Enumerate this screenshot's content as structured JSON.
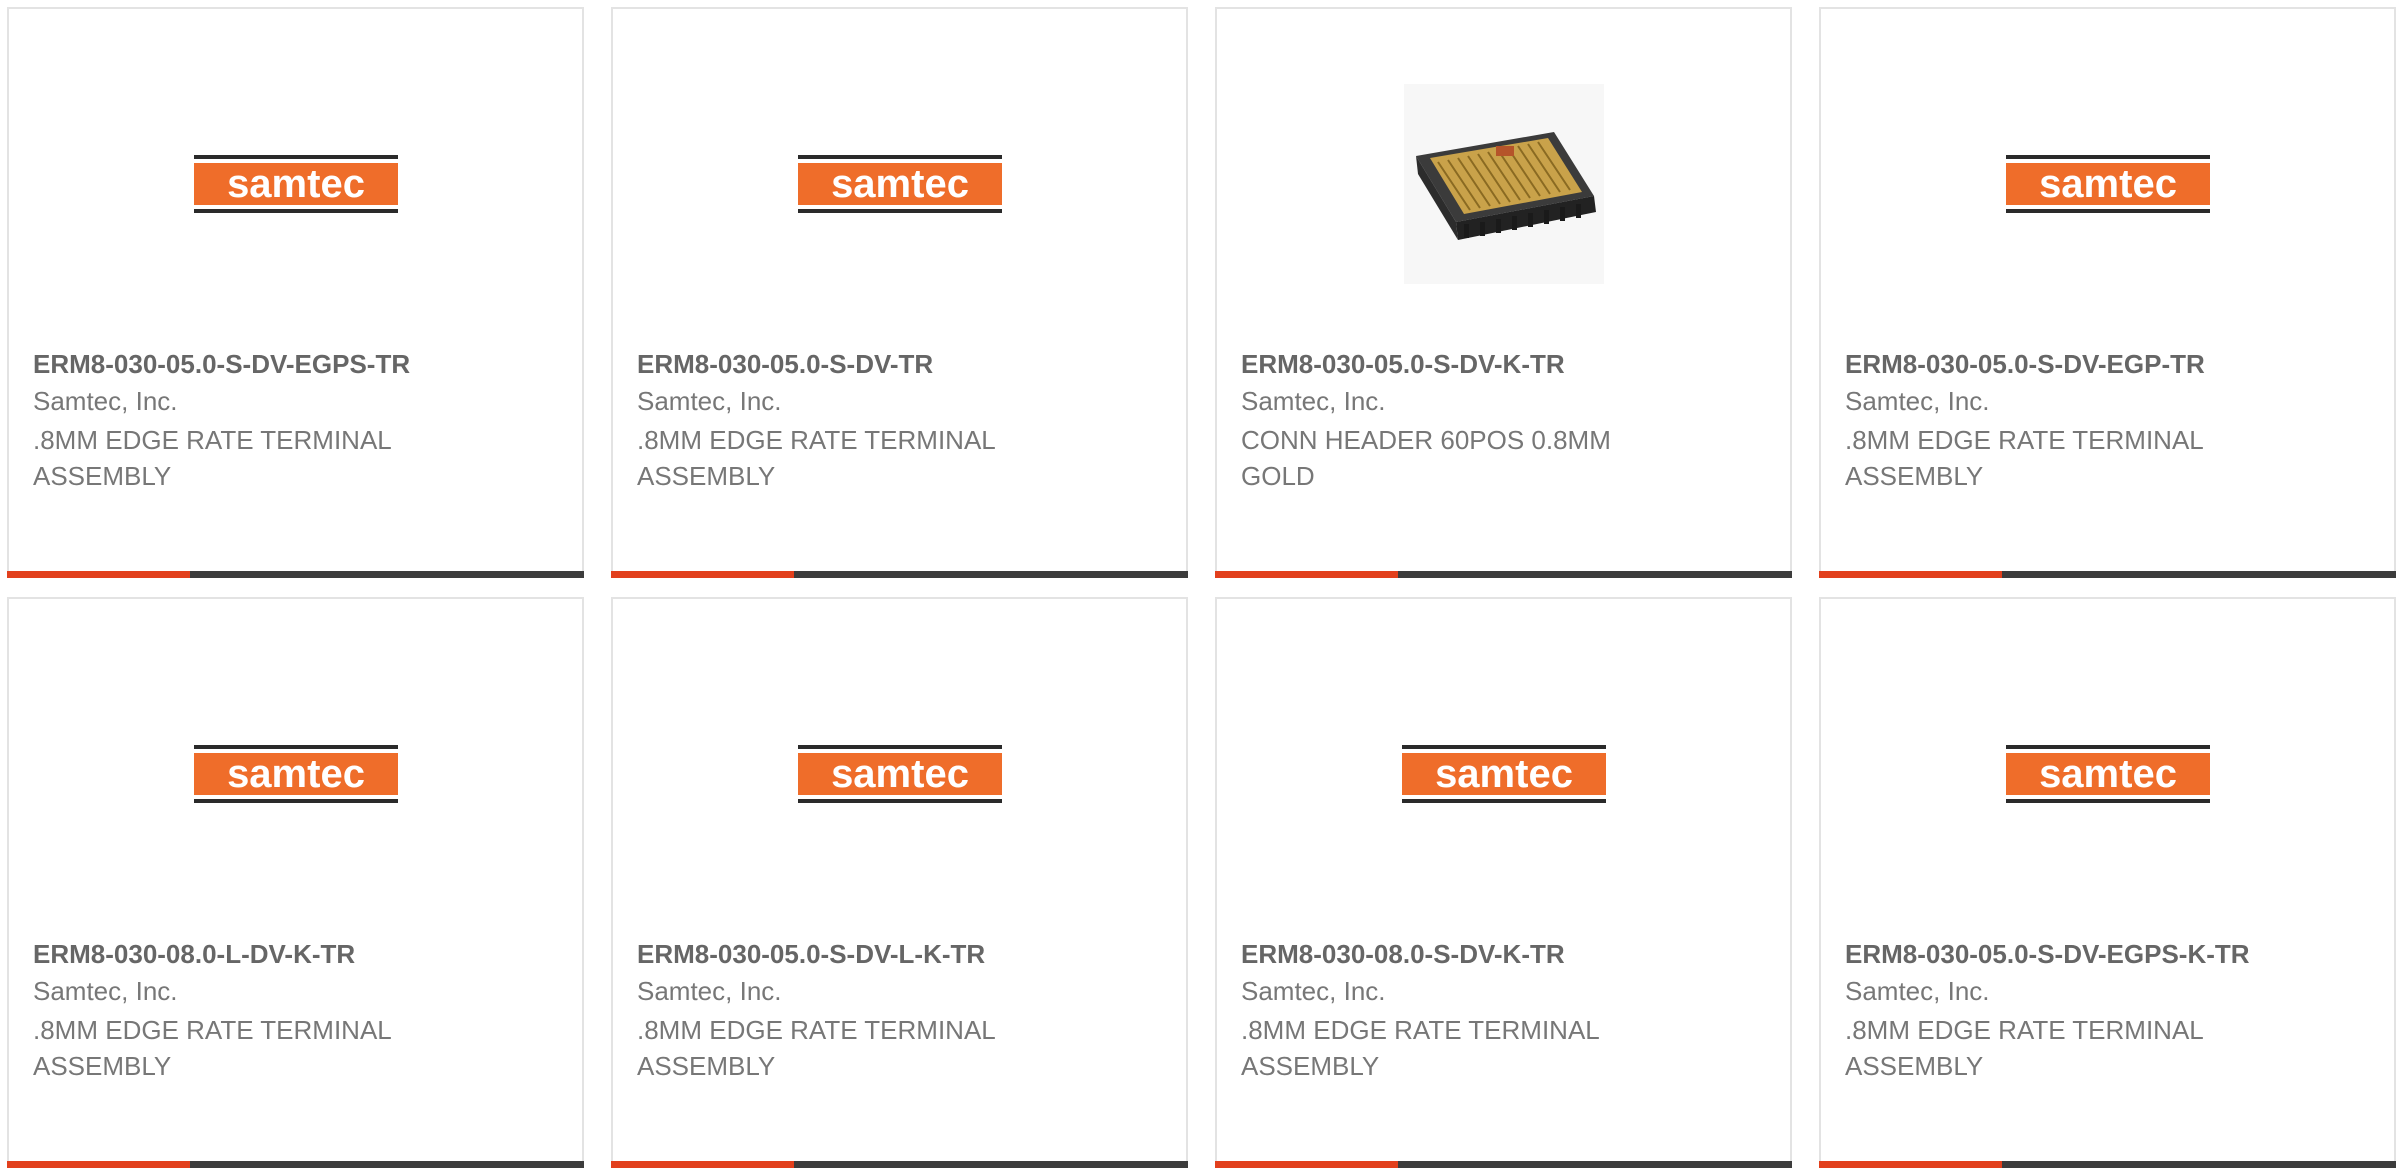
{
  "colors": {
    "accent": "#e2401d",
    "bar_dark": "#3c3c3c",
    "logo_orange": "#ef6d2a",
    "logo_dark": "#2a2a2a",
    "title_text": "#666666",
    "body_text": "#777777"
  },
  "logo_text": "samtec",
  "products": [
    {
      "part_number": "ERM8-030-05.0-S-DV-EGPS-TR",
      "manufacturer": "Samtec, Inc.",
      "description": ".8MM EDGE RATE TERMINAL ASSEMBLY",
      "image": "samtec-logo"
    },
    {
      "part_number": "ERM8-030-05.0-S-DV-TR",
      "manufacturer": "Samtec, Inc.",
      "description": ".8MM EDGE RATE TERMINAL ASSEMBLY",
      "image": "samtec-logo"
    },
    {
      "part_number": "ERM8-030-05.0-S-DV-K-TR",
      "manufacturer": "Samtec, Inc.",
      "description": "CONN HEADER 60POS 0.8MM GOLD",
      "image": "connector-photo"
    },
    {
      "part_number": "ERM8-030-05.0-S-DV-EGP-TR",
      "manufacturer": "Samtec, Inc.",
      "description": ".8MM EDGE RATE TERMINAL ASSEMBLY",
      "image": "samtec-logo"
    },
    {
      "part_number": "ERM8-030-08.0-L-DV-K-TR",
      "manufacturer": "Samtec, Inc.",
      "description": ".8MM EDGE RATE TERMINAL ASSEMBLY",
      "image": "samtec-logo"
    },
    {
      "part_number": "ERM8-030-05.0-S-DV-L-K-TR",
      "manufacturer": "Samtec, Inc.",
      "description": ".8MM EDGE RATE TERMINAL ASSEMBLY",
      "image": "samtec-logo"
    },
    {
      "part_number": "ERM8-030-08.0-S-DV-K-TR",
      "manufacturer": "Samtec, Inc.",
      "description": ".8MM EDGE RATE TERMINAL ASSEMBLY",
      "image": "samtec-logo"
    },
    {
      "part_number": "ERM8-030-05.0-S-DV-EGPS-K-TR",
      "manufacturer": "Samtec, Inc.",
      "description": ".8MM EDGE RATE TERMINAL ASSEMBLY",
      "image": "samtec-logo"
    }
  ]
}
